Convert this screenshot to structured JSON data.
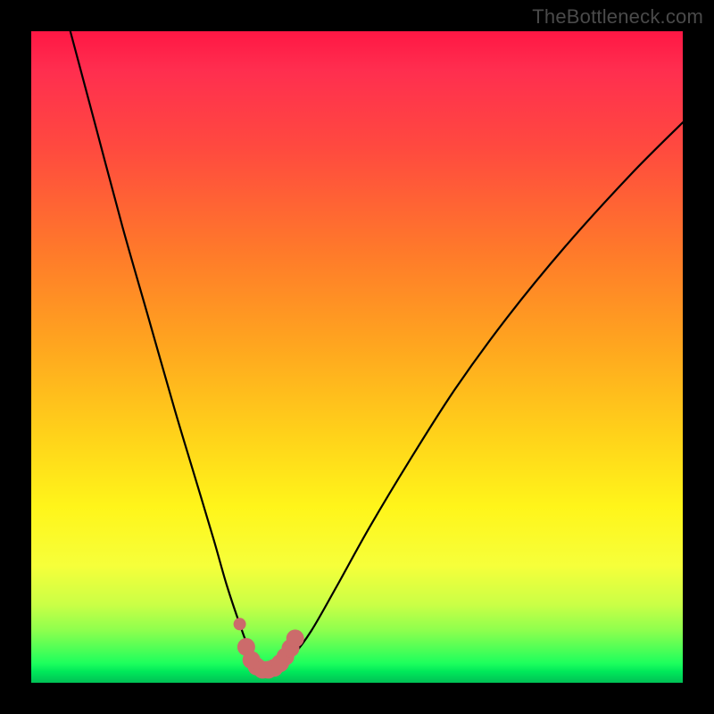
{
  "watermark": "TheBottleneck.com",
  "colors": {
    "frame": "#000000",
    "gradient_top": "#ff1744",
    "gradient_bottom": "#00c055",
    "curve": "#000000",
    "marker": "#cc6b6b"
  },
  "chart_data": {
    "type": "line",
    "title": "",
    "xlabel": "",
    "ylabel": "",
    "xlim": [
      0,
      100
    ],
    "ylim": [
      0,
      100
    ],
    "note": "No axis ticks or numeric labels are rendered in the image; values below are geometric estimates of the plotted curve in percent of the plot area (x left→right, y bottom→top).",
    "series": [
      {
        "name": "bottleneck-curve",
        "x": [
          6,
          10,
          14,
          18,
          22,
          25,
          28,
          30,
          32,
          33.5,
          35,
          36.5,
          38,
          40,
          43,
          47,
          52,
          58,
          65,
          73,
          82,
          92,
          100
        ],
        "y": [
          100,
          85,
          70,
          56,
          42,
          32,
          22,
          15,
          9,
          5,
          2.5,
          2,
          2.5,
          4,
          8,
          15,
          24,
          34,
          45,
          56,
          67,
          78,
          86
        ]
      }
    ],
    "markers": {
      "name": "highlight-dots",
      "color": "#cc6b6b",
      "points_xy": [
        [
          32.0,
          9.0
        ],
        [
          33.0,
          5.5
        ],
        [
          33.8,
          3.5
        ],
        [
          34.6,
          2.5
        ],
        [
          35.5,
          2.0
        ],
        [
          36.4,
          2.0
        ],
        [
          37.3,
          2.3
        ],
        [
          38.2,
          3.0
        ],
        [
          39.0,
          4.0
        ],
        [
          39.8,
          5.3
        ],
        [
          40.5,
          6.8
        ]
      ]
    }
  }
}
